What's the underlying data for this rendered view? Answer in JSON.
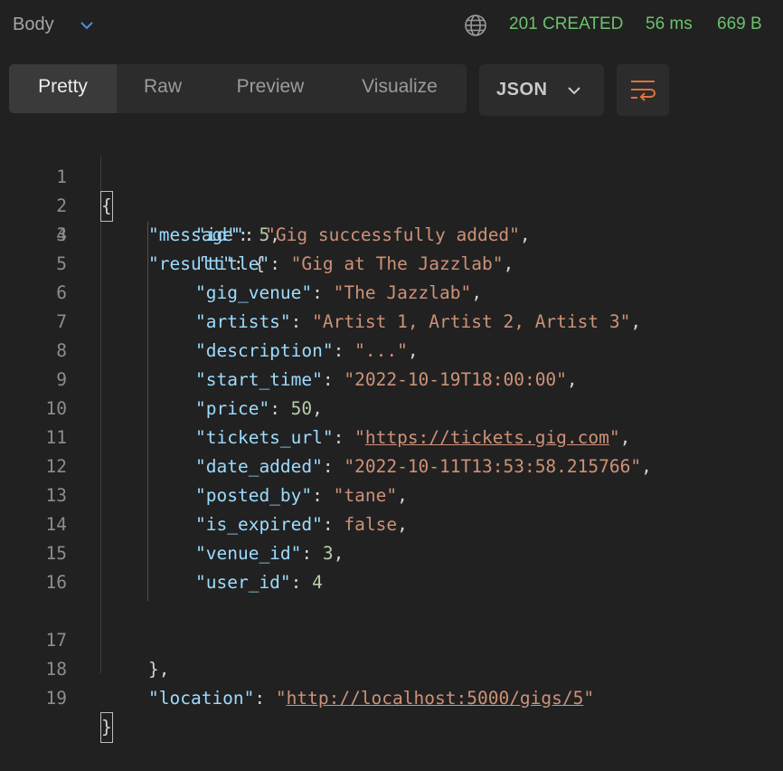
{
  "topbar": {
    "body_label": "Body",
    "status": "201 CREATED",
    "time": "56 ms",
    "size": "669 B",
    "status_color": "#6cc26c",
    "globe_icon": "globe-icon",
    "caret_icon": "chevron-down-icon"
  },
  "tabs": [
    {
      "label": "Pretty",
      "active": true
    },
    {
      "label": "Raw",
      "active": false
    },
    {
      "label": "Preview",
      "active": false
    },
    {
      "label": "Visualize",
      "active": false
    }
  ],
  "format": {
    "label": "JSON",
    "icon": "chevron-down-icon"
  },
  "wrap_button": {
    "icon": "wrap-lines-icon",
    "color": "#e0723a"
  },
  "code": {
    "line_numbers": [
      "1",
      "2",
      "3",
      "4",
      "5",
      "6",
      "7",
      "8",
      "9",
      "10",
      "11",
      "12",
      "13",
      "14",
      "15",
      "16",
      "17",
      "18",
      "19"
    ],
    "open_brace": "{",
    "close_brace": "}",
    "message_key": "\"message\"",
    "message_value": "\"Gig successfully added\"",
    "result_key": "\"result\"",
    "result_open": "{",
    "result_close": "},",
    "fields": [
      {
        "key": "\"id\"",
        "value": "5",
        "type": "n",
        "comma": ","
      },
      {
        "key": "\"title\"",
        "value": "\"Gig at The Jazzlab\"",
        "type": "s",
        "comma": ","
      },
      {
        "key": "\"gig_venue\"",
        "value": "\"The Jazzlab\"",
        "type": "s",
        "comma": ","
      },
      {
        "key": "\"artists\"",
        "value": "\"Artist 1, Artist 2, Artist 3\"",
        "type": "s",
        "comma": ","
      },
      {
        "key": "\"description\"",
        "value": "\"...\"",
        "type": "s",
        "comma": ","
      },
      {
        "key": "\"start_time\"",
        "value": "\"2022-10-19T18:00:00\"",
        "type": "s",
        "comma": ","
      },
      {
        "key": "\"price\"",
        "value": "50",
        "type": "n",
        "comma": ","
      },
      {
        "key": "\"tickets_url\"",
        "value": "https://tickets.gig.com",
        "type": "u",
        "comma": ","
      },
      {
        "key": "\"date_added\"",
        "value": "\"2022-10-11T13:53:58.215766\"",
        "type": "s",
        "comma": ","
      },
      {
        "key": "\"posted_by\"",
        "value": "\"tane\"",
        "type": "s",
        "comma": ","
      },
      {
        "key": "\"is_expired\"",
        "value": "false",
        "type": "b",
        "comma": ","
      },
      {
        "key": "\"venue_id\"",
        "value": "3",
        "type": "n",
        "comma": ","
      },
      {
        "key": "\"user_id\"",
        "value": "4",
        "type": "n",
        "comma": ""
      }
    ],
    "location_key": "\"location\"",
    "location_value": "http://localhost:5000/gigs/5"
  }
}
